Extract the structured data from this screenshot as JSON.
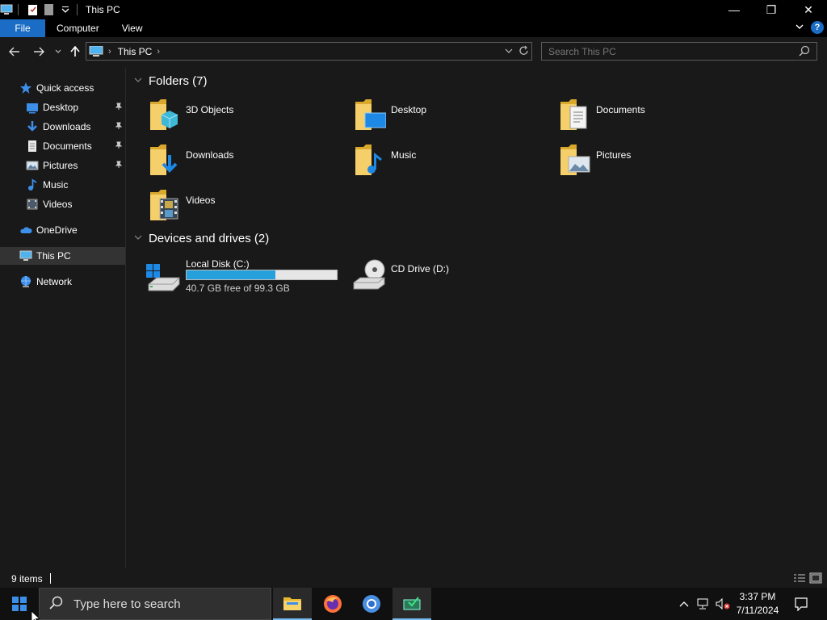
{
  "window": {
    "title": "This PC",
    "controls": {
      "minimize": "—",
      "maximize": "❐",
      "close": "✕"
    }
  },
  "ribbon": {
    "tabs": [
      "File",
      "Computer",
      "View"
    ],
    "expand_icon": "⌄",
    "help_icon": "?"
  },
  "address": {
    "crumbs": [
      "This PC"
    ],
    "separator": "›",
    "dropdown": "⌄",
    "refresh": "↻"
  },
  "search": {
    "placeholder": "Search This PC",
    "icon": "search-icon"
  },
  "nav": {
    "back": "←",
    "forward": "→",
    "recent": "⌄",
    "up": "↑"
  },
  "sidebar": {
    "items": [
      {
        "label": "Quick access",
        "icon": "star-icon"
      },
      {
        "label": "Desktop",
        "icon": "desktop-icon",
        "pinned": true
      },
      {
        "label": "Downloads",
        "icon": "download-icon",
        "pinned": true
      },
      {
        "label": "Documents",
        "icon": "document-icon",
        "pinned": true
      },
      {
        "label": "Pictures",
        "icon": "pictures-icon",
        "pinned": true
      },
      {
        "label": "Music",
        "icon": "music-icon"
      },
      {
        "label": "Videos",
        "icon": "videos-icon"
      },
      {
        "label": "OneDrive",
        "icon": "cloud-icon"
      },
      {
        "label": "This PC",
        "icon": "computer-icon",
        "selected": true
      },
      {
        "label": "Network",
        "icon": "network-icon"
      }
    ],
    "pin_glyph": "📌"
  },
  "content": {
    "folders_header": "Folders (7)",
    "folders": [
      {
        "name": "3D Objects",
        "icon": "3d-objects-icon"
      },
      {
        "name": "Desktop",
        "icon": "desktop-folder-icon"
      },
      {
        "name": "Documents",
        "icon": "documents-folder-icon"
      },
      {
        "name": "Downloads",
        "icon": "downloads-folder-icon"
      },
      {
        "name": "Music",
        "icon": "music-folder-icon"
      },
      {
        "name": "Pictures",
        "icon": "pictures-folder-icon"
      },
      {
        "name": "Videos",
        "icon": "videos-folder-icon"
      }
    ],
    "drives_header": "Devices and drives (2)",
    "drives": [
      {
        "name": "Local Disk (C:)",
        "free_text": "40.7 GB free of 99.3 GB",
        "used_fraction": 0.59,
        "icon": "hard-disk-icon"
      },
      {
        "name": "CD Drive (D:)",
        "icon": "cd-drive-icon"
      }
    ]
  },
  "status": {
    "count": "9 items"
  },
  "taskbar": {
    "search_placeholder": "Type here to search",
    "apps": [
      "file-explorer-icon",
      "firefox-icon",
      "chromium-icon",
      "app-icon"
    ],
    "time": "3:37 PM",
    "date": "7/11/2024"
  },
  "colors": {
    "accent": "#1a6cc4",
    "progress": "#26a0da",
    "folder": "#f0c860",
    "background": "#191919"
  }
}
